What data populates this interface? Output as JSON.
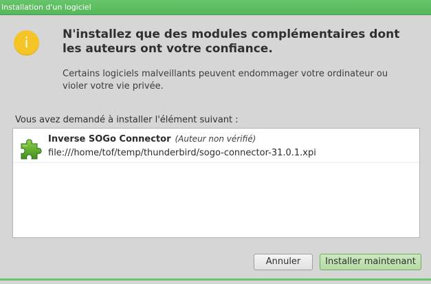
{
  "window": {
    "title": "Installation d'un logiciel"
  },
  "warning": {
    "icon": "info-warning-icon",
    "glyph": "i",
    "color": "#f5c527",
    "headline": "N'installez que des modules complémentaires dont\nles auteurs ont votre confiance.",
    "message": "Certains logiciels malveillants peuvent endommager votre ordinateur ou\nvioler votre vie privée."
  },
  "request": {
    "label": "Vous avez demandé à installer l'élément suivant :"
  },
  "addons": [
    {
      "icon": "puzzle-piece-icon",
      "name": "Inverse SOGo Connector",
      "author": "(Auteur non vérifié)",
      "url": "file:///home/tof/temp/thunderbird/sogo-connector-31.0.1.xpi"
    }
  ],
  "buttons": {
    "cancel": "Annuler",
    "install": "Installer maintenant"
  },
  "colors": {
    "accent": "#56b85a",
    "background": "#d6d6d6"
  }
}
